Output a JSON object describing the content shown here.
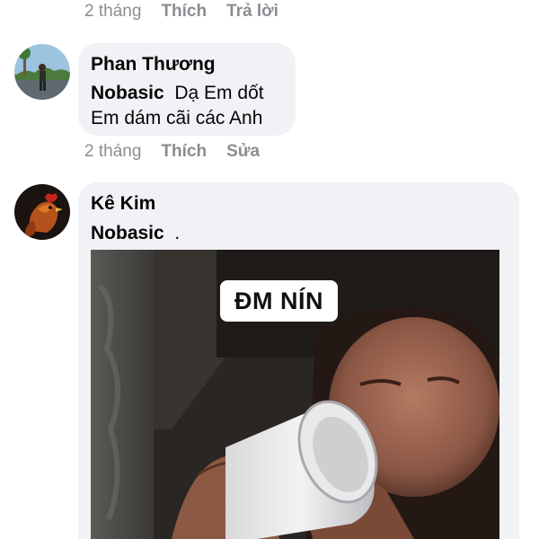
{
  "top_actions": {
    "time": "2 tháng",
    "like": "Thích",
    "reply": "Trả lời"
  },
  "comments": [
    {
      "author": "Phan Thương",
      "mention": "Nobasic",
      "text_line1": "Dạ Em dốt",
      "text_line2": "Em dám cãi các Anh",
      "actions": {
        "time": "2 tháng",
        "like": "Thích",
        "edit": "Sửa"
      }
    },
    {
      "author": "Kê Kim",
      "mention": "Nobasic",
      "text": ".",
      "image_caption": "ĐM NÍN"
    }
  ]
}
